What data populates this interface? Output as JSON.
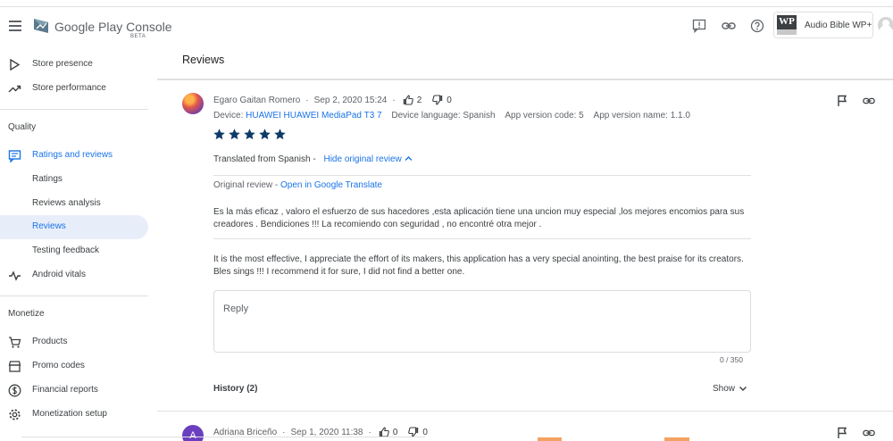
{
  "header": {
    "brand_main": "Google Play",
    "brand_console": "Console",
    "beta": "BETA",
    "app_icon_text": "WP",
    "app_name": "Audio Bible WP+"
  },
  "sidebar": {
    "items_top": [
      {
        "label": "Store presence",
        "icon": "play-icon"
      },
      {
        "label": "Store performance",
        "icon": "trending-up-icon"
      }
    ],
    "quality_section": "Quality",
    "quality_items": [
      {
        "label": "Ratings and reviews",
        "icon": "reviews-icon"
      },
      {
        "label": "Ratings"
      },
      {
        "label": "Reviews analysis"
      },
      {
        "label": "Reviews"
      },
      {
        "label": "Testing feedback"
      },
      {
        "label": "Android vitals",
        "icon": "vitals-icon"
      }
    ],
    "monetize_section": "Monetize",
    "monetize_items": [
      {
        "label": "Products",
        "icon": "cart-icon"
      },
      {
        "label": "Promo codes",
        "icon": "store-icon"
      },
      {
        "label": "Financial reports",
        "icon": "dollar-icon"
      },
      {
        "label": "Monetization setup",
        "icon": "gear-icon"
      }
    ]
  },
  "page": {
    "title": "Reviews"
  },
  "review1": {
    "author": "Egaro Gaitan Romero",
    "date": "Sep 2, 2020 15:24",
    "likes": "2",
    "dislikes": "0",
    "device_label": "Device:",
    "device_value": "HUAWEI HUAWEI MediaPad T3 7",
    "language": "Device language: Spanish",
    "version_code": "App version code: 5",
    "version_name": "App version name: 1.1.0",
    "rating": 5,
    "translated_from": "Translated from Spanish -",
    "hide_original": "Hide original review",
    "original_label": "Original review -",
    "open_translate": "Open in Google Translate",
    "original_text": "Es la más eficaz , valoro el esfuerzo de sus hacedores ,esta aplicación tiene una uncion muy especial ,los mejores encomios para sus creadores . Bendiciones !!! La recomiendo con seguridad , no encontré otra mejor .",
    "translated_text": "It is the most effective, I appreciate the effort of its makers, this application has a very special anointing, the best praise for its creators. Bles sings !!! I recommend it for sure, I did not find a better one.",
    "reply_placeholder": "Reply",
    "counter": "0 / 350",
    "history": "History (2)",
    "show": "Show"
  },
  "review2": {
    "avatar_letter": "A",
    "author": "Adriana Briceño",
    "date": "Sep 1, 2020 11:38",
    "likes": "0",
    "dislikes": "0"
  },
  "colors": {
    "accent": "#1a73e8",
    "star": "#0d3b66",
    "active_bg": "#e8eef9"
  }
}
